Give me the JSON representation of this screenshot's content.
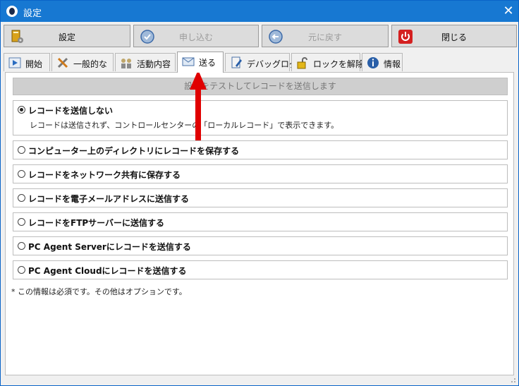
{
  "window": {
    "title": "設定",
    "close_glyph": "✕"
  },
  "toolbar": {
    "buttons": [
      {
        "label": "設定",
        "enabled": true,
        "icon": "settings-book-icon"
      },
      {
        "label": "申し込む",
        "enabled": false,
        "icon": "apply-clock-icon"
      },
      {
        "label": "元に戻す",
        "enabled": false,
        "icon": "revert-clock-icon"
      },
      {
        "label": "閉じる",
        "enabled": true,
        "icon": "power-icon"
      }
    ]
  },
  "tabs": [
    {
      "label": "開始",
      "icon": "play-icon",
      "active": false
    },
    {
      "label": "一般的な",
      "icon": "tools-icon",
      "active": false
    },
    {
      "label": "活動内容",
      "icon": "users-icon",
      "active": false
    },
    {
      "label": "送る",
      "icon": "send-icon",
      "active": true
    },
    {
      "label": "デバッグログ",
      "icon": "debug-log-icon",
      "active": false
    },
    {
      "label": "ロックを解除",
      "icon": "unlock-icon",
      "active": false
    },
    {
      "label": "情報",
      "icon": "info-icon",
      "active": false
    }
  ],
  "send": {
    "test_button_label": "設定をテストしてレコードを送信します",
    "options": [
      {
        "label": "レコードを送信しない",
        "selected": true,
        "description": "レコードは送信されず、コントロールセンターの「ローカルレコード」で表示できます。"
      },
      {
        "label": "コンピューター上のディレクトリにレコードを保存する",
        "selected": false
      },
      {
        "label": "レコードをネットワーク共有に保存する",
        "selected": false
      },
      {
        "label": "レコードを電子メールアドレスに送信する",
        "selected": false
      },
      {
        "label": "レコードをFTPサーバーに送信する",
        "selected": false
      },
      {
        "label": "PC Agent Serverにレコードを送信する",
        "selected": false
      },
      {
        "label": "PC Agent Cloudにレコードを送信する",
        "selected": false
      }
    ],
    "note": "* この情報は必須です。その他はオプションです。"
  },
  "colors": {
    "titlebar": "#1778d2",
    "annotation_arrow": "#e00000"
  }
}
